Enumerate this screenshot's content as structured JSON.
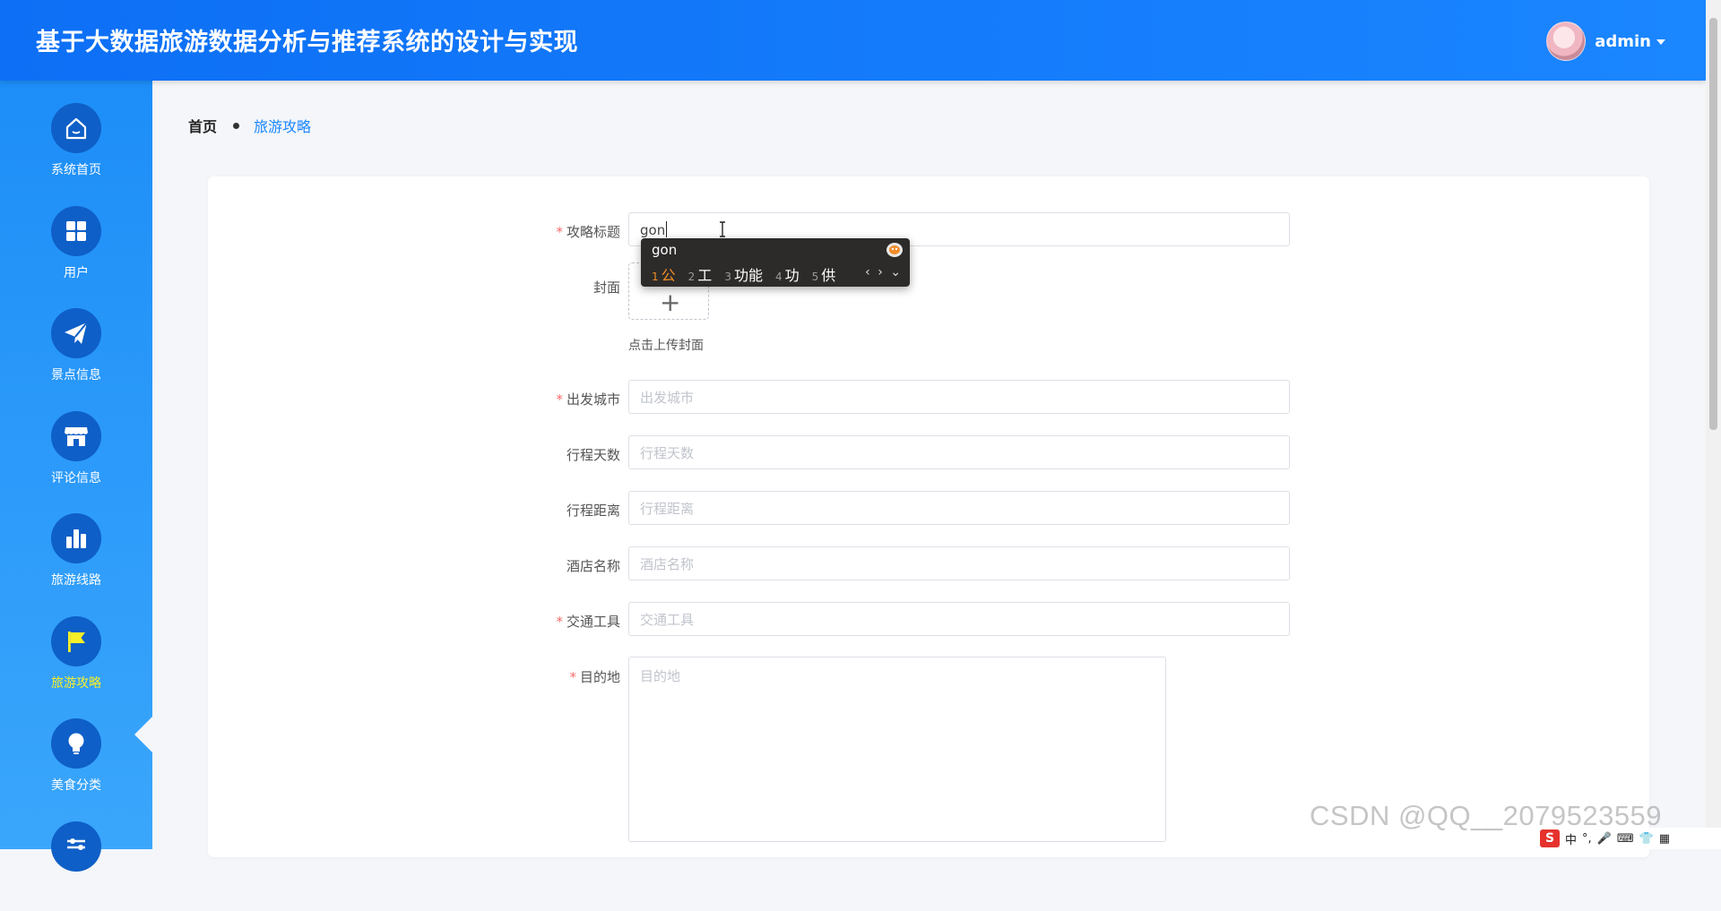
{
  "header": {
    "title": "基于大数据旅游数据分析与推荐系统的设计与实现",
    "username": "admin"
  },
  "sidebar": {
    "items": [
      {
        "label": "系统首页",
        "icon": "home-icon"
      },
      {
        "label": "用户",
        "icon": "grid-icon"
      },
      {
        "label": "景点信息",
        "icon": "paper-plane-icon"
      },
      {
        "label": "评论信息",
        "icon": "shop-icon"
      },
      {
        "label": "旅游线路",
        "icon": "bar-chart-icon"
      },
      {
        "label": "旅游攻略",
        "icon": "flag-icon",
        "active": true
      },
      {
        "label": "美食分类",
        "icon": "lightbulb-icon"
      },
      {
        "label": "",
        "icon": "sliders-icon"
      }
    ]
  },
  "breadcrumb": {
    "home": "首页",
    "current": "旅游攻略"
  },
  "form": {
    "title_label": "攻略标题",
    "title_value": "gon",
    "cover_label": "封面",
    "cover_hint": "点击上传封面",
    "fields": [
      {
        "label": "出发城市",
        "placeholder": "出发城市",
        "required": true
      },
      {
        "label": "行程天数",
        "placeholder": "行程天数",
        "required": false
      },
      {
        "label": "行程距离",
        "placeholder": "行程距离",
        "required": false
      },
      {
        "label": "酒店名称",
        "placeholder": "酒店名称",
        "required": false
      },
      {
        "label": "交通工具",
        "placeholder": "交通工具",
        "required": true
      }
    ],
    "destination_label": "目的地",
    "destination_placeholder": "目的地"
  },
  "ime": {
    "input": "gon",
    "candidates": [
      {
        "num": "1",
        "word": "公"
      },
      {
        "num": "2",
        "word": "工"
      },
      {
        "num": "3",
        "word": "功能"
      },
      {
        "num": "4",
        "word": "功"
      },
      {
        "num": "5",
        "word": "供"
      }
    ],
    "nav": "‹ › ⌄"
  },
  "watermark": "CSDN @QQ__2079523559",
  "tray": {
    "lang": "中",
    "punct": "°,"
  },
  "colors": {
    "header": "#1a86ff",
    "sidebar": "#2a9bfa",
    "active_label": "#f7ef29",
    "required": "#f56c6c",
    "ime_highlight": "#f28c28"
  }
}
